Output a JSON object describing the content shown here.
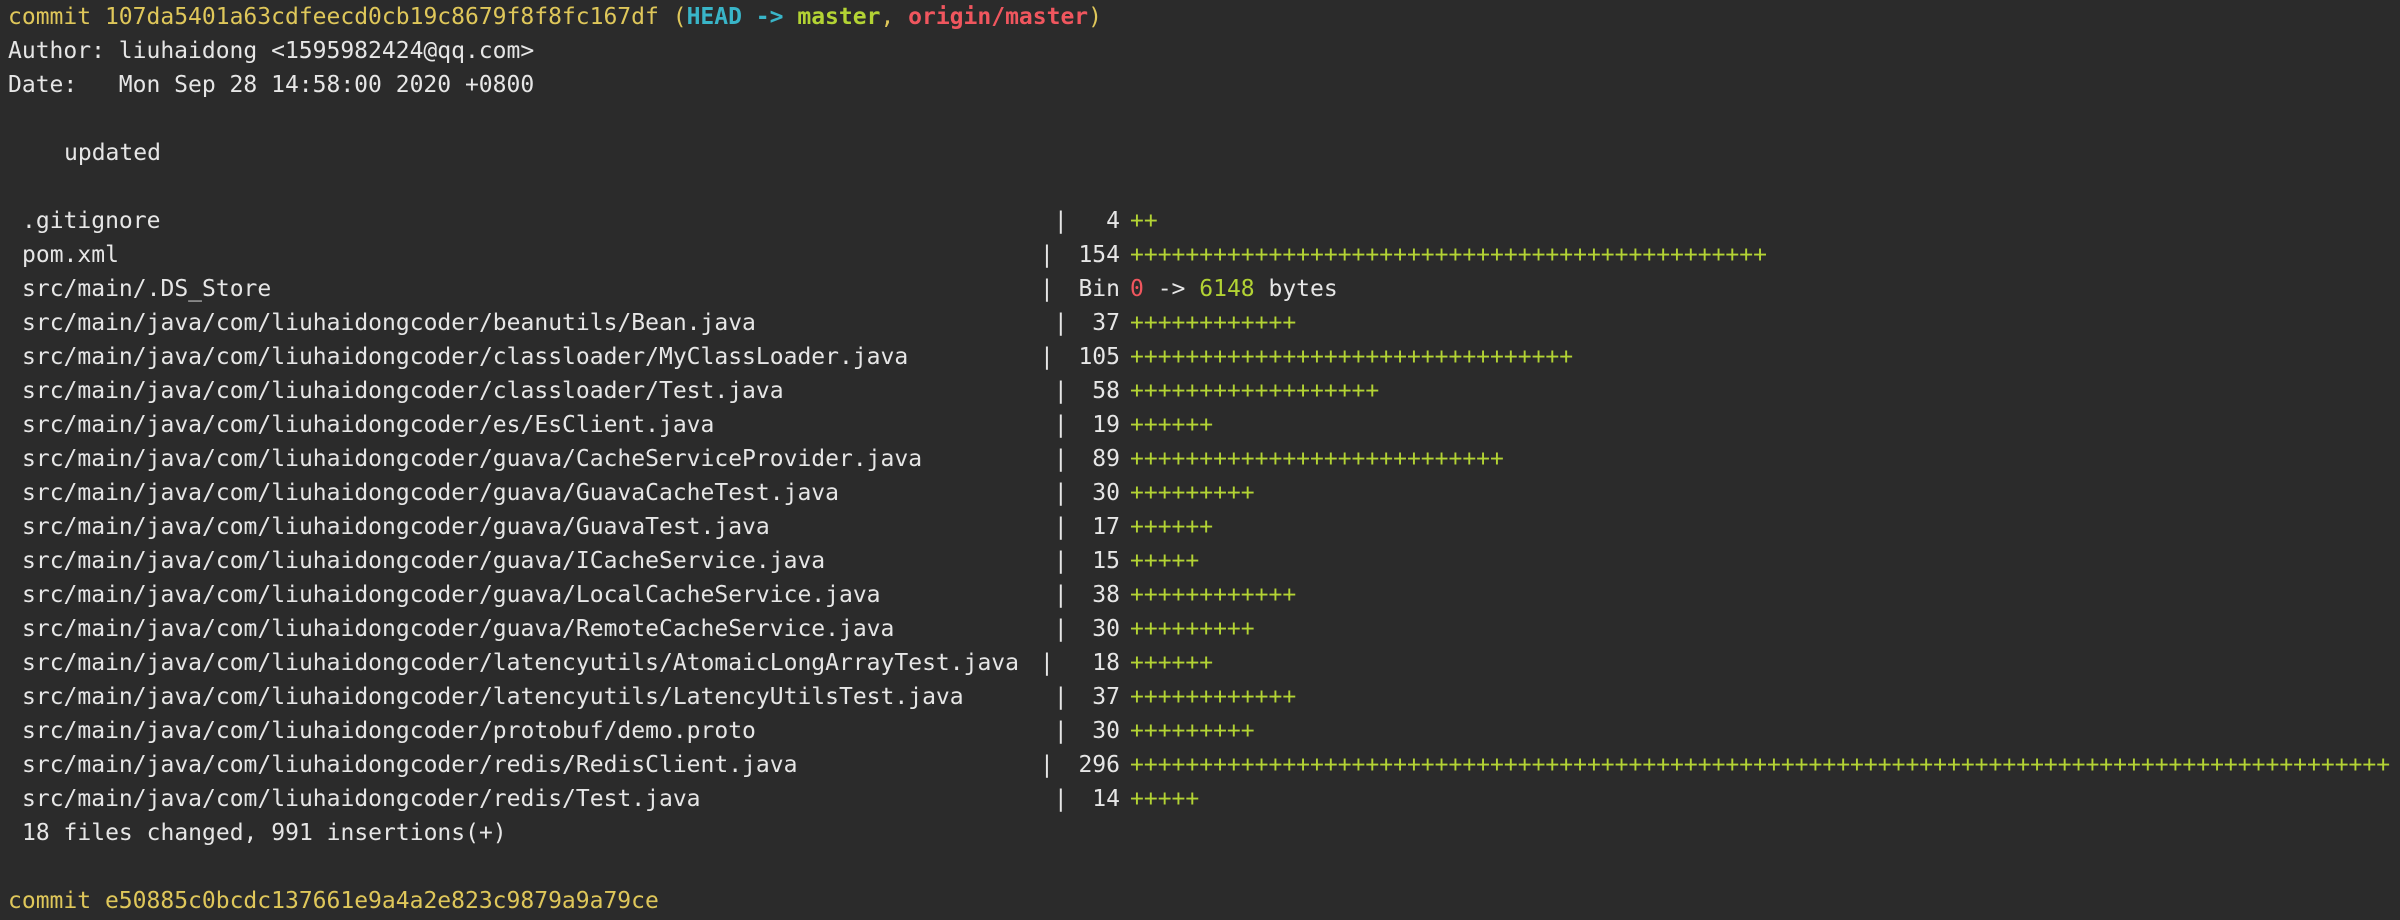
{
  "commit1": {
    "label": "commit",
    "hash": "107da5401a63cdfeecd0cb19c8679f8f8fc167df",
    "paren_open": "(",
    "head": "HEAD",
    "arrow": " -> ",
    "branch": "master",
    "comma": ", ",
    "remote": "origin/master",
    "paren_close": ")",
    "author_line": "Author: liuhaidong <1595982424@qq.com>",
    "date_line": "Date:   Mon Sep 28 14:58:00 2020 +0800",
    "message": "updated"
  },
  "stat": [
    {
      "path": ".gitignore",
      "sep": " |",
      "count": "4",
      "bar": "++"
    },
    {
      "path": "pom.xml",
      "sep": "|",
      "count": "154",
      "bar": "++++++++++++++++++++++++++++++++++++++++++++++"
    },
    {
      "path": "src/main/.DS_Store",
      "sep": "|",
      "bin": true,
      "count": "Bin",
      "from": "0",
      "arrow": " -> ",
      "to": "6148",
      "unit": " bytes"
    },
    {
      "path": "src/main/java/com/liuhaidongcoder/beanutils/Bean.java",
      "sep": " |",
      "count": "37",
      "bar": "++++++++++++"
    },
    {
      "path": "src/main/java/com/liuhaidongcoder/classloader/MyClassLoader.java",
      "sep": "|",
      "count": "105",
      "bar": "++++++++++++++++++++++++++++++++"
    },
    {
      "path": "src/main/java/com/liuhaidongcoder/classloader/Test.java",
      "sep": " |",
      "count": "58",
      "bar": "++++++++++++++++++"
    },
    {
      "path": "src/main/java/com/liuhaidongcoder/es/EsClient.java",
      "sep": " |",
      "count": "19",
      "bar": "++++++"
    },
    {
      "path": "src/main/java/com/liuhaidongcoder/guava/CacheServiceProvider.java",
      "sep": " |",
      "count": "89",
      "bar": "+++++++++++++++++++++++++++"
    },
    {
      "path": "src/main/java/com/liuhaidongcoder/guava/GuavaCacheTest.java",
      "sep": " |",
      "count": "30",
      "bar": "+++++++++"
    },
    {
      "path": "src/main/java/com/liuhaidongcoder/guava/GuavaTest.java",
      "sep": " |",
      "count": "17",
      "bar": "++++++"
    },
    {
      "path": "src/main/java/com/liuhaidongcoder/guava/ICacheService.java",
      "sep": " |",
      "count": "15",
      "bar": "+++++"
    },
    {
      "path": "src/main/java/com/liuhaidongcoder/guava/LocalCacheService.java",
      "sep": " |",
      "count": "38",
      "bar": "++++++++++++"
    },
    {
      "path": "src/main/java/com/liuhaidongcoder/guava/RemoteCacheService.java",
      "sep": " |",
      "count": "30",
      "bar": "+++++++++"
    },
    {
      "path": "src/main/java/com/liuhaidongcoder/latencyutils/AtomaicLongArrayTest.java",
      "sep": "|",
      "count": "18",
      "bar": "++++++"
    },
    {
      "path": "src/main/java/com/liuhaidongcoder/latencyutils/LatencyUtilsTest.java",
      "sep": " |",
      "count": "37",
      "bar": "++++++++++++"
    },
    {
      "path": "src/main/java/com/liuhaidongcoder/protobuf/demo.proto",
      "sep": " |",
      "count": "30",
      "bar": "+++++++++"
    },
    {
      "path": "src/main/java/com/liuhaidongcoder/redis/RedisClient.java",
      "sep": "|",
      "count": "296",
      "bar": "+++++++++++++++++++++++++++++++++++++++++++++++++++++++++++++++++++++++++++++++++++++++++++"
    },
    {
      "path": "src/main/java/com/liuhaidongcoder/redis/Test.java",
      "sep": " |",
      "count": "14",
      "bar": "+++++"
    }
  ],
  "summary": "18 files changed, 991 insertions(+)",
  "commit2": {
    "label": "commit",
    "hash": "e50885c0bcdc137661e9a4a2e823c9879a9a79ce"
  }
}
